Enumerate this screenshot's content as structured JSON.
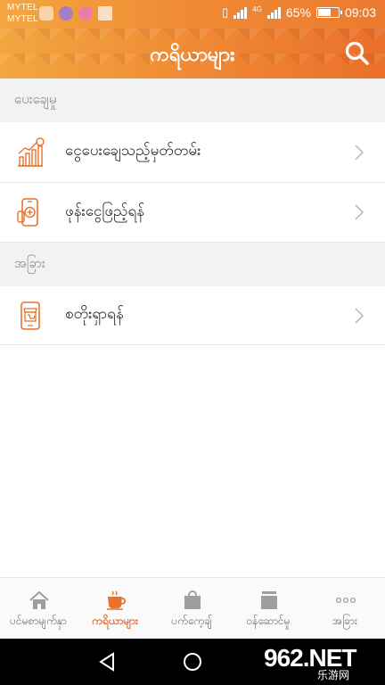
{
  "status_bar": {
    "carrier_1": "MYTEL",
    "carrier_2": "MYTEL",
    "network": "4G",
    "battery": "65%",
    "battery_level": 0.65,
    "time": "09:03"
  },
  "app_bar": {
    "title": "ကရိယာများ"
  },
  "sections": [
    {
      "header": "ပေးချေမှု",
      "items": [
        {
          "label": "ငွေပေးချေသည့်မှတ်တမ်း",
          "icon": "chart-growth-icon"
        },
        {
          "label": "ဖုန်းငွေဖြည့်ရန်",
          "icon": "phone-topup-icon"
        }
      ]
    },
    {
      "header": "အခြား",
      "items": [
        {
          "label": "စတိုးရှာရန်",
          "icon": "store-finder-icon"
        }
      ]
    }
  ],
  "bottom_nav": [
    {
      "label": "ပင်မစာမျက်နှာ",
      "icon": "home-icon",
      "active": false
    },
    {
      "label": "ကရိယာများ",
      "icon": "coffee-cup-icon",
      "active": true
    },
    {
      "label": "ပက်ကေ့ချ်",
      "icon": "bag-icon",
      "active": false
    },
    {
      "label": "ဝန်ဆောင်မှု",
      "icon": "service-icon",
      "active": false
    },
    {
      "label": "အခြား",
      "icon": "more-dots-icon",
      "active": false
    }
  ],
  "watermark": {
    "logo": "962.NET",
    "sub": "乐游网"
  },
  "colors": {
    "accent": "#e9712c",
    "header_orange": "#f08a34",
    "section_bg": "#f2f2f2"
  }
}
